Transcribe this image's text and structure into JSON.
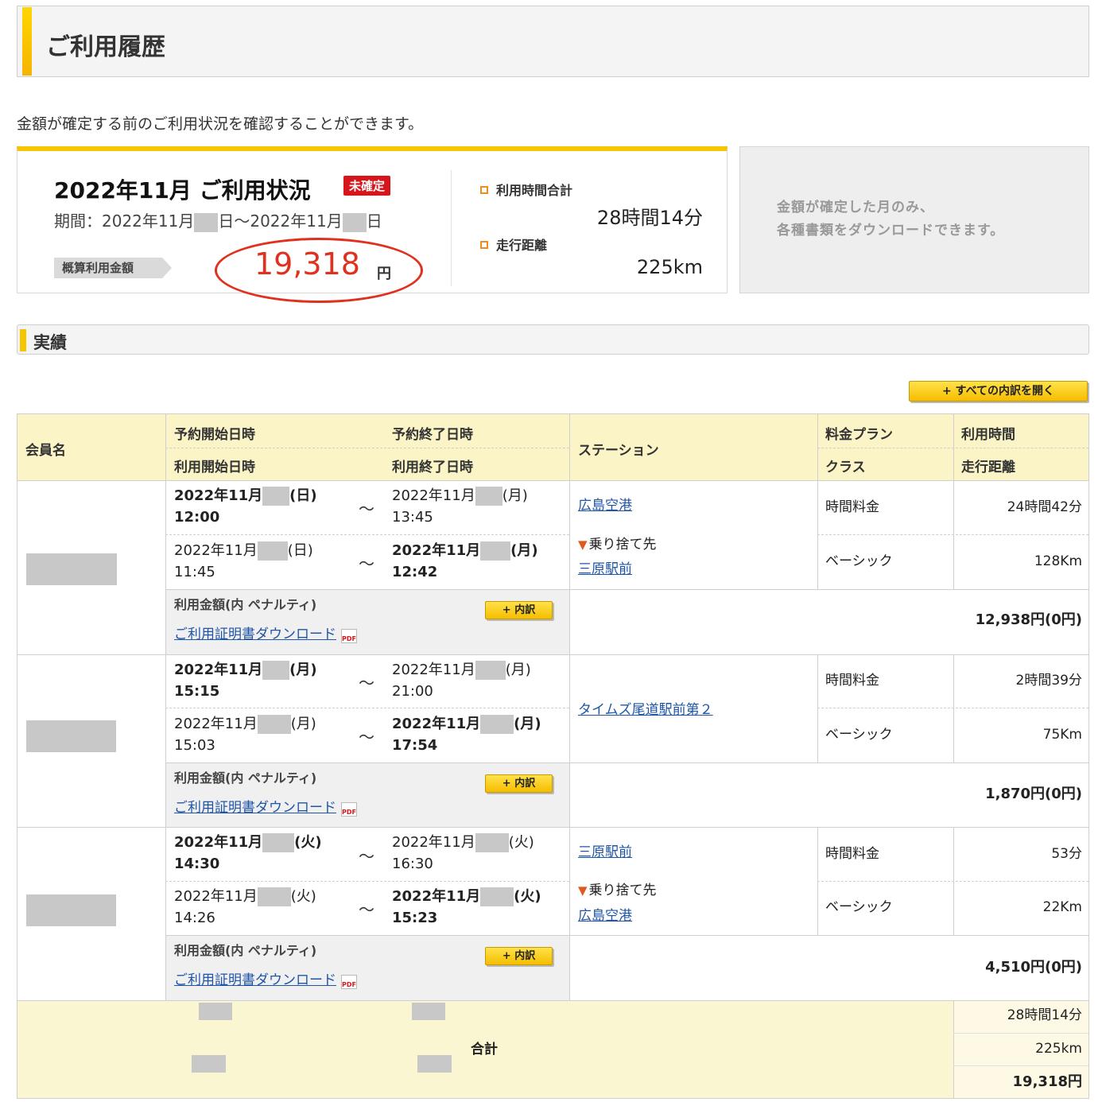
{
  "header": {
    "title": "ご利用履歴"
  },
  "intro": "金額が確定する前のご利用状況を確認することができます。",
  "summary": {
    "title": "2022年11月 ご利用状況",
    "status_badge": "未確定",
    "period_label": "期間：2022年11月",
    "period_mid": "日〜2022年11月",
    "period_end": "日",
    "amount_label": "概算利用金額",
    "amount": "19,318",
    "amount_unit": "円",
    "time_label": "利用時間合計",
    "time_value": "28時間14分",
    "distance_label": "走行距離",
    "distance_value": "225km"
  },
  "download_note": {
    "line1": "金額が確定した月のみ、",
    "line2": "各種書類をダウンロードできます。"
  },
  "section": {
    "title": "実績"
  },
  "open_all_label": "+ すべての内訳を開く",
  "table": {
    "headers": {
      "member": "会員名",
      "reserve_start": "予約開始日時",
      "use_start": "利用開始日時",
      "reserve_end": "予約終了日時",
      "use_end": "利用終了日時",
      "station": "ステーション",
      "plan": "料金プラン",
      "class": "クラス",
      "use_time": "利用時間",
      "distance": "走行距離"
    },
    "rows": [
      {
        "reserve_start_date": "2022年11月",
        "reserve_start_day": "(日)",
        "reserve_start_time": "12:00",
        "reserve_end_date": "2022年11月",
        "reserve_end_day": "(月)",
        "reserve_end_time": "13:45",
        "use_start_date": "2022年11月",
        "use_start_day": "(日)",
        "use_start_time": "11:45",
        "use_end_date": "2022年11月",
        "use_end_day": "(月)",
        "use_end_time": "12:42",
        "station": "広島空港",
        "dropoff_label": "乗り捨て先",
        "dropoff_station": "三原駅前",
        "plan": "時間料金",
        "class": "ベーシック",
        "use_time": "24時間42分",
        "distance": "128Km",
        "amount_label": "利用金額(内 ペナルティ)",
        "download_label": "ご利用証明書ダウンロード",
        "detail_label": "+ 内訳",
        "amount": "12,938円(0円)"
      },
      {
        "reserve_start_date": "2022年11月",
        "reserve_start_day": "(月)",
        "reserve_start_time": "15:15",
        "reserve_end_date": "2022年11月",
        "reserve_end_day": "(月)",
        "reserve_end_time": "21:00",
        "use_start_date": "2022年11月",
        "use_start_day": "(月)",
        "use_start_time": "15:03",
        "use_end_date": "2022年11月",
        "use_end_day": "(月)",
        "use_end_time": "17:54",
        "station": "タイムズ尾道駅前第２",
        "dropoff_label": "",
        "dropoff_station": "",
        "plan": "時間料金",
        "class": "ベーシック",
        "use_time": "2時間39分",
        "distance": "75Km",
        "amount_label": "利用金額(内 ペナルティ)",
        "download_label": "ご利用証明書ダウンロード",
        "detail_label": "+ 内訳",
        "amount": "1,870円(0円)"
      },
      {
        "reserve_start_date": "2022年11月",
        "reserve_start_day": "(火)",
        "reserve_start_time": "14:30",
        "reserve_end_date": "2022年11月",
        "reserve_end_day": "(火)",
        "reserve_end_time": "16:30",
        "use_start_date": "2022年11月",
        "use_start_day": "(火)",
        "use_start_time": "14:26",
        "use_end_date": "2022年11月",
        "use_end_day": "(火)",
        "use_end_time": "15:23",
        "station": "三原駅前",
        "dropoff_label": "乗り捨て先",
        "dropoff_station": "広島空港",
        "plan": "時間料金",
        "class": "ベーシック",
        "use_time": "53分",
        "distance": "22Km",
        "amount_label": "利用金額(内 ペナルティ)",
        "download_label": "ご利用証明書ダウンロード",
        "detail_label": "+ 内訳",
        "amount": "4,510円(0円)"
      }
    ],
    "total": {
      "label": "合計",
      "use_time": "28時間14分",
      "distance": "225km",
      "amount": "19,318円"
    }
  },
  "colors": {
    "accent": "#f7c400",
    "header_bg": "#fbf4c6",
    "link": "#1f55a8",
    "alert": "#e0301e",
    "badge": "#d7161c"
  },
  "icons": {
    "pdf": "pdf-icon",
    "dropoff": "triangle-down-icon"
  }
}
